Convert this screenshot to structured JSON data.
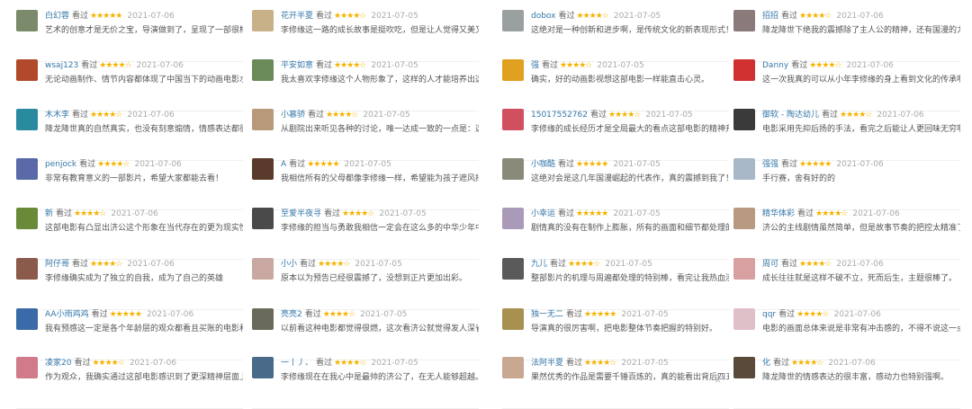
{
  "columns": [
    {
      "items": [
        {
          "user": "白幻蓉",
          "watched": "看过",
          "stars": "★★★★★",
          "date": "2021-07-06",
          "comment": "艺术的创意才是无价之宝，导演做到了，呈现了一部很棒的作品。",
          "avatar_color": "#7a8a6a"
        },
        {
          "user": "wsaj123",
          "watched": "看过",
          "stars": "★★★★☆",
          "date": "2021-07-06",
          "comment": "无论动画制作、情节内容都体现了中国当下的动画电影水准。",
          "avatar_color": "#b04a2a"
        },
        {
          "user": "木木李",
          "watched": "看过",
          "stars": "★★★★☆",
          "date": "2021-07-06",
          "comment": "降龙降世真的自然真实，也没有刻意煽情，情感表达都很细腻。",
          "avatar_color": "#2a8aa0"
        },
        {
          "user": "penjock",
          "watched": "看过",
          "stars": "★★★★☆",
          "date": "2021-07-06",
          "comment": "非常有教育意义的一部影片，希望大家都能去看！",
          "avatar_color": "#5a6aa8"
        },
        {
          "user": "新",
          "watched": "看过",
          "stars": "★★★★☆",
          "date": "2021-07-06",
          "comment": "这部电影有凸显出济公这个形象在当代存在的更为现实性的意义",
          "avatar_color": "#6a8a3a"
        },
        {
          "user": "阿仔哥",
          "watched": "看过",
          "stars": "★★★★☆",
          "date": "2021-07-06",
          "comment": "李修缘确实成为了独立的自我，成为了自己的英雄",
          "avatar_color": "#8a5a4a"
        },
        {
          "user": "AA小雨鸡鸡",
          "watched": "看过",
          "stars": "★★★★★",
          "date": "2021-07-06",
          "comment": "我有预感这一定是各个年龄层的观众都看且买账的电影和国漫！",
          "avatar_color": "#3a6aa8"
        },
        {
          "user": "凌家20",
          "watched": "看过",
          "stars": "★★★★☆",
          "date": "2021-07-06",
          "comment": "作为观众，我确实通过这部电影感识到了更深精神层面上的东西。",
          "avatar_color": "#d07a8a"
        }
      ]
    },
    {
      "items": [
        {
          "user": "花开半夏",
          "watched": "看过",
          "stars": "★★★★☆",
          "date": "2021-07-05",
          "comment": "李修缘这一路的成长故事是挺吹吃，但是让人觉得又美又感动",
          "avatar_color": "#c8b088"
        },
        {
          "user": "平安如意",
          "watched": "看过",
          "stars": "★★★★☆",
          "date": "2021-07-05",
          "comment": "我太喜欢李修缘这个人物形象了，这样的人才能培养出这么优秀的儿子。",
          "avatar_color": "#6a8a5a"
        },
        {
          "user": "小慕骄",
          "watched": "看过",
          "stars": "★★★★☆",
          "date": "2021-07-05",
          "comment": "从剧院出来听见各种的讨论，唯一达成一致的一点是：这真的是一部好电影！",
          "avatar_color": "#b89a7a"
        },
        {
          "user": "A",
          "watched": "看过",
          "stars": "★★★★★",
          "date": "2021-07-05",
          "comment": "我相信所有的父母都像李修缘一样，希望能为孩子遮风挡雨吧。",
          "avatar_color": "#5a3a2a"
        },
        {
          "user": "至爱半夜寻",
          "watched": "看过",
          "stars": "★★★★☆",
          "date": "2021-07-05",
          "comment": "李修缘的担当与勇敢我相信一定会在这么多的中华少年中传承。",
          "avatar_color": "#4a4a4a"
        },
        {
          "user": "小小",
          "watched": "看过",
          "stars": "★★★★☆",
          "date": "2021-07-05",
          "comment": "原本以为预告已经很震撼了，没想到正片更加出彩。",
          "avatar_color": "#c8a8a0"
        },
        {
          "user": "亮亮2",
          "watched": "看过",
          "stars": "★★★★☆",
          "date": "2021-07-05",
          "comment": "以前看这种电影都觉得很燃，这次看济公就觉得发人深省",
          "avatar_color": "#6a6a5a"
        },
        {
          "user": "一丨丿、",
          "watched": "看过",
          "stars": "★★★★☆",
          "date": "2021-07-05",
          "comment": "李修缘现在在我心中是最帅的济公了，在无人能够超越。",
          "avatar_color": "#4a6a8a"
        }
      ]
    },
    {
      "items": [
        {
          "user": "dobox",
          "watched": "看过",
          "stars": "★★★★☆",
          "date": "2021-07-05",
          "comment": "这绝对是一种创新和进步啊，是传统文化的新表现形式！",
          "avatar_color": "#9aa0a0"
        },
        {
          "user": "强",
          "watched": "看过",
          "stars": "★★★★☆",
          "date": "2021-07-05",
          "comment": "确实，好的动画影视想这部电影一样能直击心灵。",
          "avatar_color": "#e0a020"
        },
        {
          "user": "15017552762",
          "watched": "看过",
          "stars": "★★★★☆",
          "date": "2021-07-05",
          "comment": "李修缘的成长经历才是全局最大的看点这部电影的精神升华了。",
          "avatar_color": "#d05060"
        },
        {
          "user": "小咖酷",
          "watched": "看过",
          "stars": "★★★★★",
          "date": "2021-07-05",
          "comment": "这绝对会是这几年国漫崛起的代表作，真的震撼到我了！",
          "avatar_color": "#8a8a7a"
        },
        {
          "user": "小幸运",
          "watched": "看过",
          "stars": "★★★★★",
          "date": "2021-07-05",
          "comment": "剧情真的没有在制作上膨胀，所有的画面和细节都处理的很完美。",
          "avatar_color": "#a89ab8"
        },
        {
          "user": "九儿",
          "watched": "看过",
          "stars": "★★★★☆",
          "date": "2021-07-05",
          "comment": "整部影片的机理与周遍都处理的特别棒，看完让我热血沸腾啊。",
          "avatar_color": "#5a5a5a"
        },
        {
          "user": "独一无二",
          "watched": "看过",
          "stars": "★★★★★",
          "date": "2021-07-05",
          "comment": "导演真的很厉害啊，把电影整体节奏把握的特别好。",
          "avatar_color": "#a89050"
        },
        {
          "user": "法阿半夏",
          "watched": "看过",
          "stars": "★★★★☆",
          "date": "2021-07-05",
          "comment": "果然优秀的作品是需要千锤百炼的，真的能看出背后四五年的用心！",
          "avatar_color": "#c8a890"
        }
      ]
    },
    {
      "items": [
        {
          "user": "招招",
          "watched": "看过",
          "stars": "★★★★☆",
          "date": "2021-07-06",
          "comment": "降龙降世下绝我的震撼除了主人公的精神，还有国漫的力量和自我的探寻。",
          "avatar_color": "#8a7a7a"
        },
        {
          "user": "Danny",
          "watched": "看过",
          "stars": "★★★★☆",
          "date": "2021-07-06",
          "comment": "这一次我真的可以从小年李修缘的身上看到文化的传承啊。",
          "avatar_color": "#d03030"
        },
        {
          "user": "御软 - 陶达幼儿",
          "watched": "看过",
          "stars": "★★★★☆",
          "date": "2021-07-06",
          "comment": "电影采用先抑后扬的手法，看完之后能让人更回味无穷啊。",
          "avatar_color": "#3a3a3a"
        },
        {
          "user": "强强",
          "watched": "看过",
          "stars": "★★★★★",
          "date": "2021-07-06",
          "comment": "手行赛，舍有好的的",
          "avatar_color": "#a8b8c8"
        },
        {
          "user": "精华体彩",
          "watched": "看过",
          "stars": "★★★★☆",
          "date": "2021-07-06",
          "comment": "济公的主线剧情虽然简单，但是故事节奏的把控太精准了吧！",
          "avatar_color": "#b89a80"
        },
        {
          "user": "周可",
          "watched": "看过",
          "stars": "★★★★☆",
          "date": "2021-07-06",
          "comment": "成长往往就是这样不破不立，死而后生，主题很棒了。",
          "avatar_color": "#d8a0a0"
        },
        {
          "user": "qqr",
          "watched": "看过",
          "stars": "★★★★☆",
          "date": "2021-07-06",
          "comment": "电影的画面总体来说是非常有冲击感的，不得不说这一点做得特别好。",
          "avatar_color": "#e0c0c8"
        },
        {
          "user": "化",
          "watched": "看过",
          "stars": "★★★★☆",
          "date": "2021-07-06",
          "comment": "降龙降世的情感表达的很丰富，感动力也特别强啊。",
          "avatar_color": "#5a4a3a"
        }
      ]
    }
  ],
  "close_glyph": "×"
}
